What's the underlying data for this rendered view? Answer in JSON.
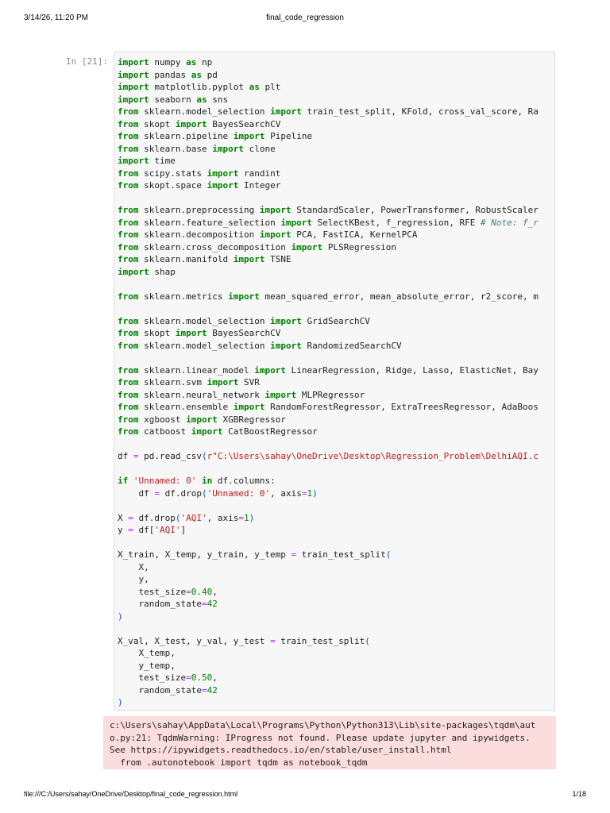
{
  "header": {
    "datetime": "3/14/26, 11:20 PM",
    "title": "final_code_regression"
  },
  "cell": {
    "prompt": "In [21]:",
    "code": [
      [
        [
          "kw",
          "import"
        ],
        [
          "t",
          " numpy "
        ],
        [
          "kw",
          "as"
        ],
        [
          "t",
          " np"
        ]
      ],
      [
        [
          "kw",
          "import"
        ],
        [
          "t",
          " pandas "
        ],
        [
          "kw",
          "as"
        ],
        [
          "t",
          " pd"
        ]
      ],
      [
        [
          "kw",
          "import"
        ],
        [
          "t",
          " matplotlib.pyplot "
        ],
        [
          "kw",
          "as"
        ],
        [
          "t",
          " plt"
        ]
      ],
      [
        [
          "kw",
          "import"
        ],
        [
          "t",
          " seaborn "
        ],
        [
          "kw",
          "as"
        ],
        [
          "t",
          " sns"
        ]
      ],
      [
        [
          "kw",
          "from"
        ],
        [
          "t",
          " sklearn.model_selection "
        ],
        [
          "kw",
          "import"
        ],
        [
          "t",
          " train_test_split, KFold, cross_val_score, Ra"
        ]
      ],
      [
        [
          "kw",
          "from"
        ],
        [
          "t",
          " skopt "
        ],
        [
          "kw",
          "import"
        ],
        [
          "t",
          " BayesSearchCV"
        ]
      ],
      [
        [
          "kw",
          "from"
        ],
        [
          "t",
          " sklearn.pipeline "
        ],
        [
          "kw",
          "import"
        ],
        [
          "t",
          " Pipeline"
        ]
      ],
      [
        [
          "kw",
          "from"
        ],
        [
          "t",
          " sklearn.base "
        ],
        [
          "kw",
          "import"
        ],
        [
          "t",
          " clone"
        ]
      ],
      [
        [
          "kw",
          "import"
        ],
        [
          "t",
          " time"
        ]
      ],
      [
        [
          "kw",
          "from"
        ],
        [
          "t",
          " scipy.stats "
        ],
        [
          "kw",
          "import"
        ],
        [
          "t",
          " randint"
        ]
      ],
      [
        [
          "kw",
          "from"
        ],
        [
          "t",
          " skopt.space "
        ],
        [
          "kw",
          "import"
        ],
        [
          "t",
          " Integer"
        ]
      ],
      [],
      [
        [
          "kw",
          "from"
        ],
        [
          "t",
          " sklearn.preprocessing "
        ],
        [
          "kw",
          "import"
        ],
        [
          "t",
          " StandardScaler, PowerTransformer, RobustScaler"
        ]
      ],
      [
        [
          "kw",
          "from"
        ],
        [
          "t",
          " sklearn.feature_selection "
        ],
        [
          "kw",
          "import"
        ],
        [
          "t",
          " SelectKBest, f_regression, RFE "
        ],
        [
          "cmt",
          "# Note: f_r"
        ]
      ],
      [
        [
          "kw",
          "from"
        ],
        [
          "t",
          " sklearn.decomposition "
        ],
        [
          "kw",
          "import"
        ],
        [
          "t",
          " PCA, FastICA, KernelPCA"
        ]
      ],
      [
        [
          "kw",
          "from"
        ],
        [
          "t",
          " sklearn.cross_decomposition "
        ],
        [
          "kw",
          "import"
        ],
        [
          "t",
          " PLSRegression"
        ]
      ],
      [
        [
          "kw",
          "from"
        ],
        [
          "t",
          " sklearn.manifold "
        ],
        [
          "kw",
          "import"
        ],
        [
          "t",
          " TSNE"
        ]
      ],
      [
        [
          "kw",
          "import"
        ],
        [
          "t",
          " shap"
        ]
      ],
      [],
      [
        [
          "kw",
          "from"
        ],
        [
          "t",
          " sklearn.metrics "
        ],
        [
          "kw",
          "import"
        ],
        [
          "t",
          " mean_squared_error, mean_absolute_error, r2_score, m"
        ]
      ],
      [],
      [
        [
          "kw",
          "from"
        ],
        [
          "t",
          " sklearn.model_selection "
        ],
        [
          "kw",
          "import"
        ],
        [
          "t",
          " GridSearchCV"
        ]
      ],
      [
        [
          "kw",
          "from"
        ],
        [
          "t",
          " skopt "
        ],
        [
          "kw",
          "import"
        ],
        [
          "t",
          " BayesSearchCV"
        ]
      ],
      [
        [
          "kw",
          "from"
        ],
        [
          "t",
          " sklearn.model_selection "
        ],
        [
          "kw",
          "import"
        ],
        [
          "t",
          " RandomizedSearchCV"
        ]
      ],
      [],
      [
        [
          "kw",
          "from"
        ],
        [
          "t",
          " sklearn.linear_model "
        ],
        [
          "kw",
          "import"
        ],
        [
          "t",
          " LinearRegression, Ridge, Lasso, ElasticNet, Bay"
        ]
      ],
      [
        [
          "kw",
          "from"
        ],
        [
          "t",
          " sklearn.svm "
        ],
        [
          "kw",
          "import"
        ],
        [
          "t",
          " SVR"
        ]
      ],
      [
        [
          "kw",
          "from"
        ],
        [
          "t",
          " sklearn.neural_network "
        ],
        [
          "kw",
          "import"
        ],
        [
          "t",
          " MLPRegressor"
        ]
      ],
      [
        [
          "kw",
          "from"
        ],
        [
          "t",
          " sklearn.ensemble "
        ],
        [
          "kw",
          "import"
        ],
        [
          "t",
          " RandomForestRegressor, ExtraTreesRegressor, AdaBoos"
        ]
      ],
      [
        [
          "kw",
          "from"
        ],
        [
          "t",
          " xgboost "
        ],
        [
          "kw",
          "import"
        ],
        [
          "t",
          " XGBRegressor"
        ]
      ],
      [
        [
          "kw",
          "from"
        ],
        [
          "t",
          " catboost "
        ],
        [
          "kw",
          "import"
        ],
        [
          "t",
          " CatBoostRegressor"
        ]
      ],
      [],
      [
        [
          "t",
          "df "
        ],
        [
          "op",
          "="
        ],
        [
          "t",
          " pd.read_csv"
        ],
        [
          "paren",
          "("
        ],
        [
          "str",
          "r\"C:\\Users\\sahay\\OneDrive\\Desktop\\Regression_Problem\\DelhiAQI.c"
        ]
      ],
      [],
      [
        [
          "kw",
          "if"
        ],
        [
          "t",
          " "
        ],
        [
          "str",
          "'Unnamed: 0'"
        ],
        [
          "t",
          " "
        ],
        [
          "kw",
          "in"
        ],
        [
          "t",
          " df.columns:"
        ]
      ],
      [
        [
          "t",
          "    df "
        ],
        [
          "op",
          "="
        ],
        [
          "t",
          " df.drop"
        ],
        [
          "paren",
          "("
        ],
        [
          "str",
          "'Unnamed: 0'"
        ],
        [
          "t",
          ", axis"
        ],
        [
          "op",
          "="
        ],
        [
          "num",
          "1"
        ],
        [
          "paren",
          ")"
        ]
      ],
      [],
      [
        [
          "t",
          "X "
        ],
        [
          "op",
          "="
        ],
        [
          "t",
          " df.drop"
        ],
        [
          "paren",
          "("
        ],
        [
          "str",
          "'AQI'"
        ],
        [
          "t",
          ", axis"
        ],
        [
          "op",
          "="
        ],
        [
          "num",
          "1"
        ],
        [
          "paren",
          ")"
        ]
      ],
      [
        [
          "t",
          "y "
        ],
        [
          "op",
          "="
        ],
        [
          "t",
          " df["
        ],
        [
          "str",
          "'AQI'"
        ],
        [
          "t",
          "]"
        ]
      ],
      [],
      [
        [
          "t",
          "X_train, X_temp, y_train, y_temp "
        ],
        [
          "op",
          "="
        ],
        [
          "t",
          " train_test_split"
        ],
        [
          "paren",
          "("
        ]
      ],
      [
        [
          "t",
          "    X,"
        ]
      ],
      [
        [
          "t",
          "    y,"
        ]
      ],
      [
        [
          "t",
          "    test_size"
        ],
        [
          "op",
          "="
        ],
        [
          "num",
          "0.40"
        ],
        [
          "t",
          ","
        ]
      ],
      [
        [
          "t",
          "    random_state"
        ],
        [
          "op",
          "="
        ],
        [
          "num",
          "42"
        ]
      ],
      [
        [
          "paren",
          ")"
        ]
      ],
      [],
      [
        [
          "t",
          "X_val, X_test, y_val, y_test "
        ],
        [
          "op",
          "="
        ],
        [
          "t",
          " train_test_split"
        ],
        [
          "paren",
          "("
        ]
      ],
      [
        [
          "t",
          "    X_temp,"
        ]
      ],
      [
        [
          "t",
          "    y_temp,"
        ]
      ],
      [
        [
          "t",
          "    test_size"
        ],
        [
          "op",
          "="
        ],
        [
          "num",
          "0.50"
        ],
        [
          "t",
          ","
        ]
      ],
      [
        [
          "t",
          "    random_state"
        ],
        [
          "op",
          "="
        ],
        [
          "num",
          "42"
        ]
      ],
      [
        [
          "paren",
          ")"
        ]
      ]
    ]
  },
  "stderr": {
    "lines": [
      "c:\\Users\\sahay\\AppData\\Local\\Programs\\Python\\Python313\\Lib\\site-packages\\tqdm\\aut",
      "o.py:21: TqdmWarning: IProgress not found. Please update jupyter and ipywidgets.",
      "See https://ipywidgets.readthedocs.io/en/stable/user_install.html",
      "  from .autonotebook import tqdm as notebook_tqdm"
    ]
  },
  "footer": {
    "path": "file:///C:/Users/sahay/OneDrive/Desktop/final_code_regression.html",
    "page": "1/18"
  }
}
